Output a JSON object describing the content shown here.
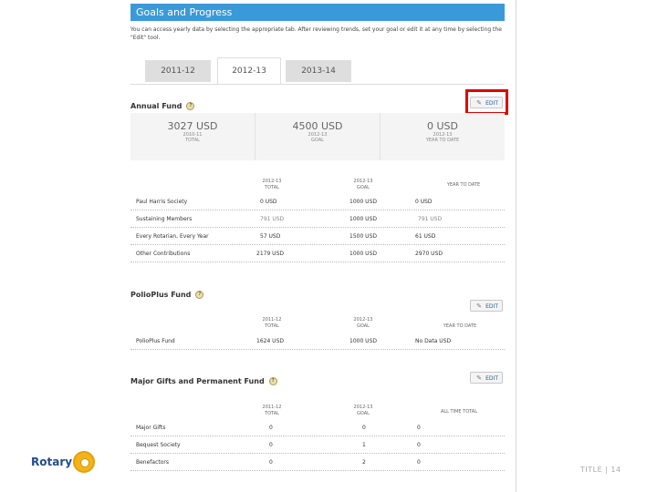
{
  "header": {
    "title": "Goals and Progress"
  },
  "intro": {
    "text": "You can access yearly data by selecting the appropriate tab. After reviewing trends, set your goal or edit it at any time by selecting the \"Edit\" tool."
  },
  "tabs": [
    {
      "label": "2011-12",
      "active": false
    },
    {
      "label": "2012-13",
      "active": true
    },
    {
      "label": "2013-14",
      "active": false
    }
  ],
  "annual_fund": {
    "title": "Annual Fund",
    "edit_label": "EDIT",
    "summary": [
      {
        "value": "3027 USD",
        "label_line1": "2010-11",
        "label_line2": "TOTAL"
      },
      {
        "value": "4500 USD",
        "label_line1": "2012-13",
        "label_line2": "GOAL"
      },
      {
        "value": "0 USD",
        "label_line1": "2012-13",
        "label_line2": "YEAR TO DATE"
      }
    ],
    "columns": [
      {
        "line1": "2012-13",
        "line2": "TOTAL"
      },
      {
        "line1": "2012-13",
        "line2": "GOAL"
      },
      {
        "line1": "YEAR TO DATE",
        "line2": ""
      }
    ],
    "rows": [
      {
        "name": "Paul Harris Society",
        "total": "0 USD",
        "goal": "1000 USD",
        "ytd": "0 USD"
      },
      {
        "name": "Sustaining Members",
        "total": "791 USD",
        "goal": "1000 USD",
        "ytd": "791 USD"
      },
      {
        "name": "Every Rotarian, Every Year",
        "total": "57 USD",
        "goal": "1500 USD",
        "ytd": "61 USD"
      },
      {
        "name": "Other Contributions",
        "total": "2179 USD",
        "goal": "1000 USD",
        "ytd": "2970 USD"
      }
    ]
  },
  "polioplus": {
    "title": "PolioPlus Fund",
    "edit_label": "EDIT",
    "columns": [
      {
        "line1": "2011-12",
        "line2": "TOTAL"
      },
      {
        "line1": "2012-13",
        "line2": "GOAL"
      },
      {
        "line1": "YEAR TO DATE",
        "line2": ""
      }
    ],
    "rows": [
      {
        "name": "PolioPlus Fund",
        "total": "1624 USD",
        "goal": "1000 USD",
        "ytd": "No Data USD"
      }
    ]
  },
  "major_gifts": {
    "title": "Major Gifts and Permanent Fund",
    "edit_label": "EDIT",
    "columns": [
      {
        "line1": "2011-12",
        "line2": "TOTAL"
      },
      {
        "line1": "2012-13",
        "line2": "GOAL"
      },
      {
        "line1": "ALL TIME TOTAL",
        "line2": ""
      }
    ],
    "rows": [
      {
        "name": "Major Gifts",
        "total": "0",
        "goal": "0",
        "ytd": "0"
      },
      {
        "name": "Bequest Society",
        "total": "0",
        "goal": "1",
        "ytd": "0"
      },
      {
        "name": "Benefactors",
        "total": "0",
        "goal": "2",
        "ytd": "0"
      }
    ]
  },
  "logo": {
    "text": "Rotary"
  },
  "footer": {
    "text": "TITLE | 14"
  },
  "colors": {
    "header_bg": "#3a9ad9",
    "highlight": "#e00000",
    "brand_blue": "#1f4d8f",
    "brand_gold": "#f2b31c"
  }
}
